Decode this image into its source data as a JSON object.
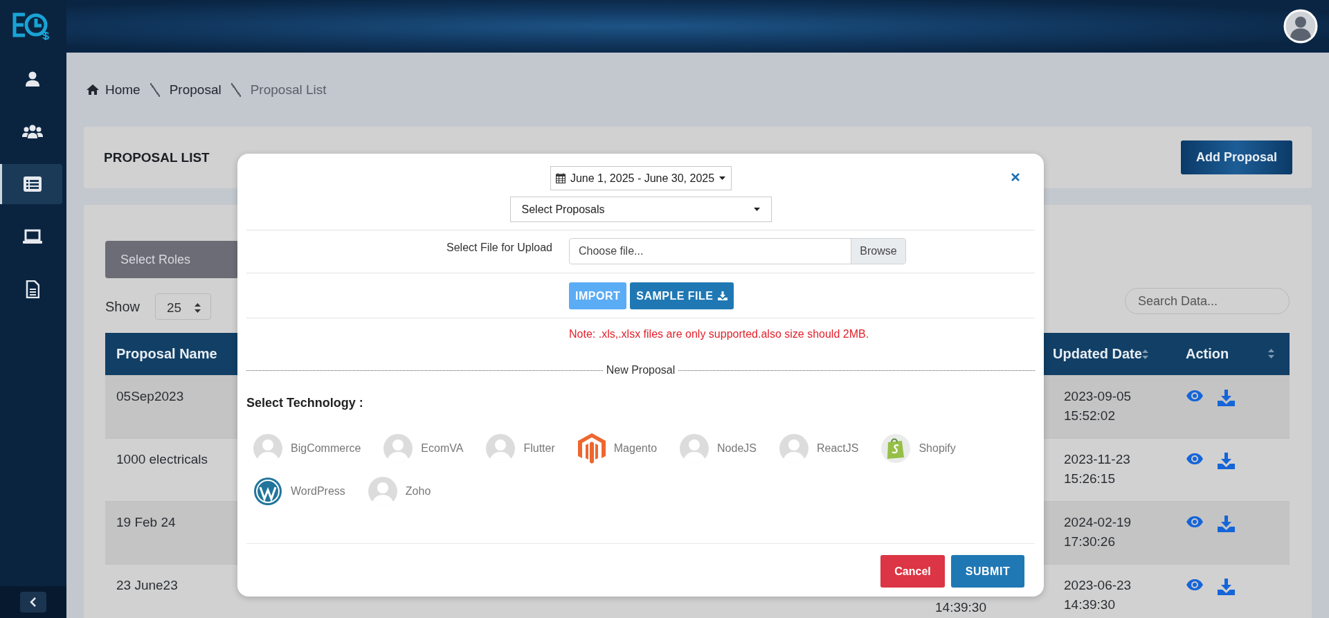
{
  "sidebar": {
    "items": [
      {
        "kind": "user",
        "selected": false
      },
      {
        "kind": "users",
        "selected": false
      },
      {
        "kind": "list",
        "selected": true
      },
      {
        "kind": "laptop",
        "selected": false
      },
      {
        "kind": "file",
        "selected": false
      }
    ]
  },
  "breadcrumb": [
    "Home",
    "Proposal",
    "Proposal List"
  ],
  "page_title": "PROPOSAL LIST",
  "add_button": "Add Proposal",
  "filters": {
    "roles_placeholder": "Select Roles",
    "show_label": "Show",
    "page_size": "25",
    "search_placeholder": "Search Data..."
  },
  "table": {
    "columns": [
      "Proposal Name",
      "Updated Date",
      "Action"
    ],
    "rows": [
      {
        "name": "05Sep2023",
        "updated": "2023-09-05 15:52:02"
      },
      {
        "name": "1000 electricals",
        "updated": "2023-11-23 15:26:15"
      },
      {
        "name": "19 Feb 24",
        "updated": "2024-02-19 17:30:26"
      },
      {
        "name": "23 June23",
        "column_2": "14:39:30",
        "updated": "2023-06-23 14:39:30"
      }
    ]
  },
  "modal": {
    "date_range": "June 1, 2025 - June 30, 2025",
    "proposals_select": "Select Proposals",
    "file_label": "Select File for Upload",
    "file_placeholder": "Choose file...",
    "browse": "Browse",
    "import": {
      "label": "IMPORT",
      "disabled": true
    },
    "sample_file": "SAMPLE FILE",
    "note": "Note: .xls,.xlsx files are only supported.also size should 2MB.",
    "legend": "New Proposal",
    "technology_label": "Select Technology :",
    "technologies": [
      {
        "name": "BigCommerce",
        "kind": "placeholder"
      },
      {
        "name": "EcomVA",
        "kind": "placeholder"
      },
      {
        "name": "Flutter",
        "kind": "placeholder"
      },
      {
        "name": "Magento",
        "kind": "magento"
      },
      {
        "name": "NodeJS",
        "kind": "placeholder"
      },
      {
        "name": "ReactJS",
        "kind": "placeholder"
      },
      {
        "name": "Shopify",
        "kind": "shopify"
      },
      {
        "name": "WordPress",
        "kind": "wordpress"
      },
      {
        "name": "Zoho",
        "kind": "placeholder"
      }
    ],
    "cancel": "Cancel",
    "submit": "SUBMIT"
  }
}
